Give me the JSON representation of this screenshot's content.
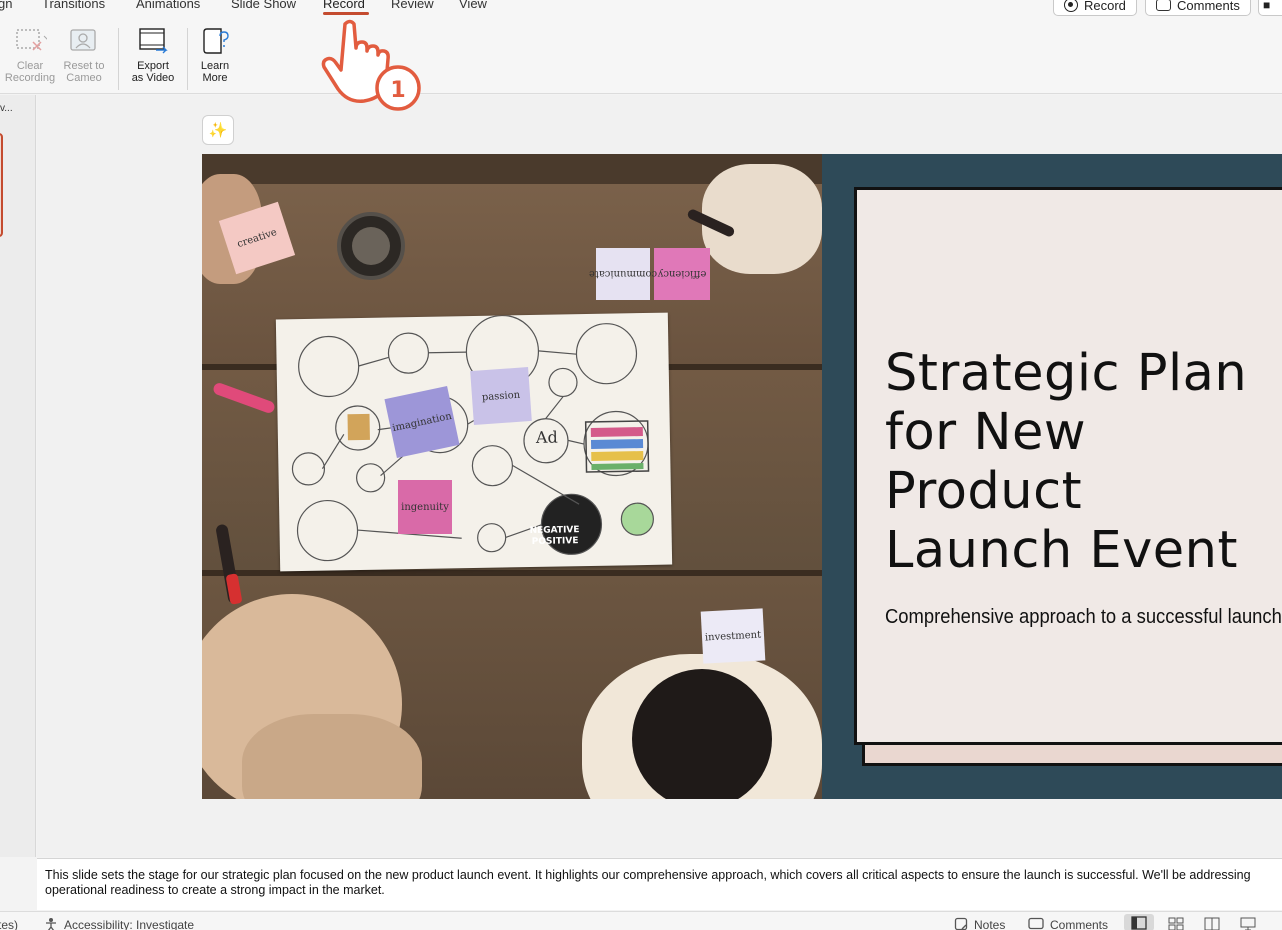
{
  "tabs": [
    {
      "label": "gn"
    },
    {
      "label": "Transitions"
    },
    {
      "label": "Animations"
    },
    {
      "label": "Slide Show"
    },
    {
      "label": "Record"
    },
    {
      "label": "Review"
    },
    {
      "label": "View"
    }
  ],
  "active_tab": "Record",
  "top_buttons": {
    "record": "Record",
    "comments": "Comments"
  },
  "ribbon": {
    "clear_recording": [
      "Clear",
      "Recording"
    ],
    "reset_cameo": [
      "Reset to",
      "Cameo"
    ],
    "export_video": [
      "Export",
      "as Video"
    ],
    "learn_more": [
      "Learn",
      "More"
    ]
  },
  "left_pane": {
    "fragment": "v..."
  },
  "cursor": {
    "step": "1"
  },
  "slide": {
    "title": "Strategic Plan for New Product Launch Event",
    "subtitle": "Comprehensive approach to a successful launch",
    "photo_notes": [
      "passion",
      "imagination",
      "ingenuity",
      "efficiency",
      "communicate",
      "investment",
      "creative"
    ]
  },
  "notes": {
    "text": "This slide sets the stage for our strategic plan focused on the new product launch event. It highlights our comprehensive approach, which covers all critical aspects to ensure the launch is successful. We'll be addressing operational readiness to create a strong impact in the market."
  },
  "status": {
    "left_fragment": "tes)",
    "accessibility": "Accessibility: Investigate",
    "notes": "Notes",
    "comments": "Comments"
  },
  "colors": {
    "accent": "#c44b2f",
    "slide_bg": "#2e4a58",
    "panel": "#f0e9e6"
  }
}
